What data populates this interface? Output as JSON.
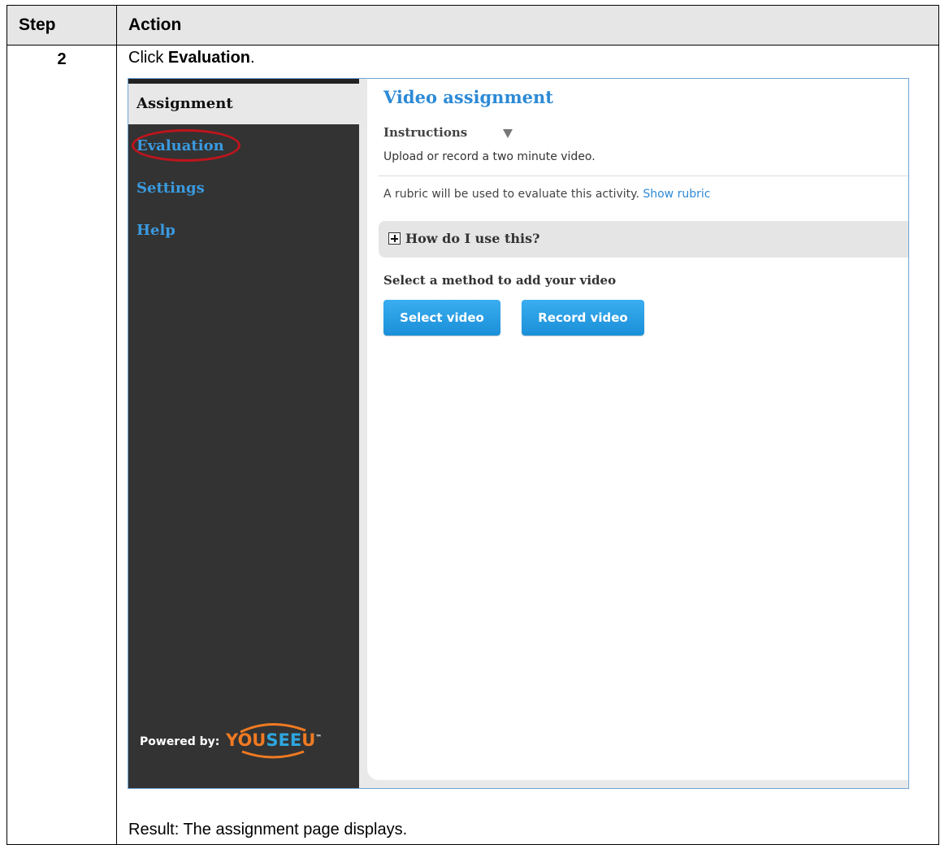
{
  "table": {
    "header_step": "Step",
    "header_action": "Action",
    "step_number": "2",
    "instruction_prefix": "Click ",
    "instruction_bold": "Evaluation",
    "instruction_suffix": ".",
    "result": "Result: The assignment page displays."
  },
  "app": {
    "sidebar": {
      "items": [
        {
          "label": "Assignment"
        },
        {
          "label": "Evaluation"
        },
        {
          "label": "Settings"
        },
        {
          "label": "Help"
        }
      ],
      "powered_by": "Powered by:",
      "logo_text_you": "YOU",
      "logo_text_see": "SEE",
      "logo_text_u": "U",
      "logo_tm": "™"
    },
    "main": {
      "title": "Video assignment",
      "instructions_label": "Instructions",
      "instructions_text": "Upload or record a two minute video.",
      "rubric_text": "A rubric will be used to evaluate this activity.",
      "rubric_link": "Show rubric",
      "howto_label": "How do I use this?",
      "method_label": "Select a method to add your video",
      "select_button": "Select video",
      "record_button": "Record video"
    }
  },
  "colors": {
    "highlight_circle": "#c0141c",
    "link_blue": "#2d8ad6",
    "sidebar_bg": "#333333",
    "button_blue": "#1b8fd8"
  }
}
